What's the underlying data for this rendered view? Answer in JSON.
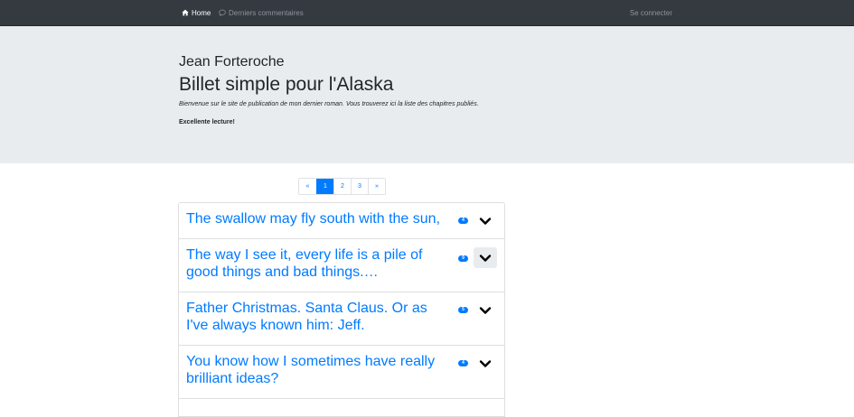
{
  "navbar": {
    "home_label": "Home",
    "comments_label": "Derniers commentaires",
    "login_label": "Se connecter",
    "home_icon": "home-icon",
    "comments_icon": "comment-icon"
  },
  "jumbotron": {
    "author": "Jean Forteroche",
    "title": "Billet simple pour l'Alaska",
    "welcome": "Bienvenue sur le site de publication de mon dernier roman. Vous trouverez ici la liste des chapitres publiés.",
    "cta": "Excellente lecture!"
  },
  "pagination": {
    "prev": "«",
    "pages": [
      "1",
      "2",
      "3"
    ],
    "active": "1",
    "next": "»"
  },
  "chapters": [
    {
      "title": "The swallow may fly south with the sun,",
      "count": "4"
    },
    {
      "title": "The way I see it, every life is a pile of good things and bad things.…",
      "count": "9"
    },
    {
      "title": "Father Christmas. Santa Claus. Or as I've always known him: Jeff.",
      "count": "5"
    },
    {
      "title": "You know how I sometimes have really brilliant ideas?",
      "count": "4"
    }
  ],
  "colors": {
    "navbar": "#343a40",
    "jumbotron": "#e9ecef",
    "accent": "#007bff"
  }
}
